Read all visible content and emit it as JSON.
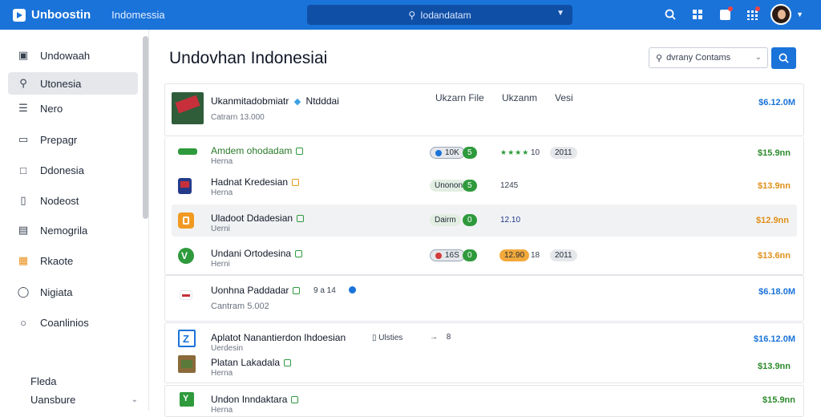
{
  "topbar": {
    "brand": "Unboostin",
    "subtitle": "Indomessia",
    "search_text": "Iodandatam",
    "accent": "#1a73d9"
  },
  "sidebar": {
    "items": [
      {
        "label": "Undowaah",
        "icon": "window-icon"
      },
      {
        "label": "Utonesia",
        "icon": "search-doc-icon"
      },
      {
        "label": "Nero",
        "icon": "list-icon"
      },
      {
        "label": "Prepagr",
        "icon": "tag-icon"
      },
      {
        "label": "Ddonesia",
        "icon": "square-icon"
      },
      {
        "label": "Nodeost",
        "icon": "phone-icon"
      },
      {
        "label": "Nemogrila",
        "icon": "card-icon"
      },
      {
        "label": "Rkaote",
        "icon": "box-icon"
      },
      {
        "label": "Nigiata",
        "icon": "chat-icon"
      },
      {
        "label": "Coanlinios",
        "icon": "chat-bubble-icon"
      }
    ],
    "bottom": [
      {
        "label": "Fleda"
      },
      {
        "label": "Uansbure"
      }
    ]
  },
  "main": {
    "title": "Undovhan Indonesiai",
    "search_placeholder": "dvrany Contams"
  },
  "table": {
    "header": {
      "name": "Ukanmitadobmiatr",
      "tag": "Ntdddai",
      "sub": "Catrarn 13.000",
      "col1": "Ukzarn File",
      "col2": "Ukzanm",
      "col3": "Vesi",
      "price": "$6.12.0M"
    },
    "rows": [
      {
        "name": "Amdem ohodadam",
        "sub": "Herna",
        "pill1": "10K",
        "pill2": "5",
        "rating": "10",
        "extra": "2011",
        "price": "$15.9nn"
      },
      {
        "name": "Hadnat Kredesian",
        "sub": "Herna",
        "pill1": "Unonon",
        "pill2": "5",
        "rating": "1245",
        "price": "$13.9nn"
      },
      {
        "name": "Uladoot Ddadesian",
        "sub": "Uerni",
        "pill1": "Dairm",
        "pill2": "0",
        "rating": "12.10",
        "price": "$12.9nn"
      },
      {
        "name": "Undani Ortodesina",
        "sub": "Herni",
        "pill1": "16S",
        "pill2": "0",
        "pill3": "12.90",
        "rating": "18",
        "extra": "2011",
        "price": "$13.6nn"
      }
    ],
    "group2": {
      "name": "Uonhna Paddadar",
      "meta": "9 a 14",
      "sub": "Cantram 5.002",
      "price": "$6.18.0M"
    },
    "group3": {
      "name": "Aplatot Nanantierdon Ihdoesian",
      "meta1": "Ulsties",
      "meta2": "8",
      "sub": "Uerdesin",
      "price": "$16.12.0M",
      "rows": [
        {
          "name": "Platan Lakadala",
          "sub": "Herna",
          "price": "$13.9nn"
        },
        {
          "name": "Undon Inndaktara",
          "sub": "Herna",
          "price": "$15.9nn"
        }
      ]
    }
  }
}
